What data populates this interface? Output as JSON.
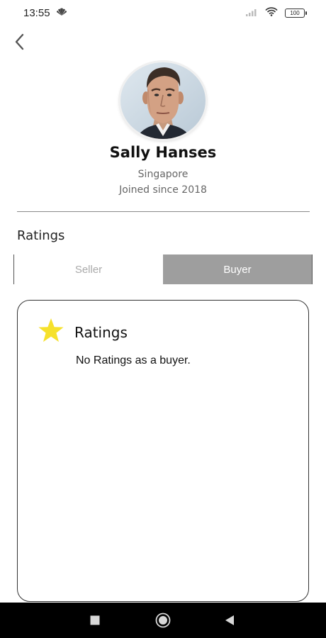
{
  "status_bar": {
    "time": "13:55",
    "battery_level": "100",
    "icons": [
      "nbc-peacock-icon",
      "signal-icon",
      "wifi-icon",
      "battery-icon"
    ]
  },
  "profile": {
    "name": "Sally Hanses",
    "location": "Singapore",
    "joined": "Joined since 2018"
  },
  "ratings_section": {
    "title": "Ratings",
    "tabs": [
      {
        "label": "Seller",
        "selected": false
      },
      {
        "label": "Buyer",
        "selected": true
      }
    ]
  },
  "ratings_card": {
    "title": "Ratings",
    "empty_message": "No Ratings as a buyer.",
    "icon": "star-icon"
  },
  "colors": {
    "tab_selected_bg": "#9e9e9e",
    "star": "#f6e12c",
    "navbar": "#000000"
  }
}
